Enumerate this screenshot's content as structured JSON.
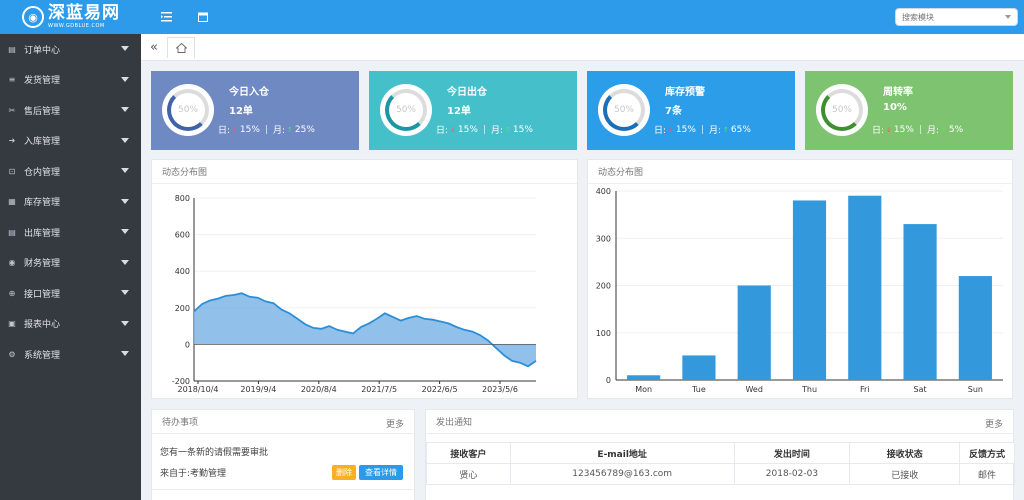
{
  "header": {
    "logo_title": "深蓝易网",
    "logo_sub": "WWW.GDBLUE.COM",
    "search_placeholder": "搜索模块"
  },
  "sidebar": {
    "items": [
      {
        "label": "订单中心",
        "icon": "order-icon"
      },
      {
        "label": "发货管理",
        "icon": "shipping-icon"
      },
      {
        "label": "售后管理",
        "icon": "aftersale-icon"
      },
      {
        "label": "入库管理",
        "icon": "inbound-icon"
      },
      {
        "label": "仓内管理",
        "icon": "warehouse-icon"
      },
      {
        "label": "库存管理",
        "icon": "inventory-icon"
      },
      {
        "label": "出库管理",
        "icon": "outbound-icon"
      },
      {
        "label": "财务管理",
        "icon": "finance-icon"
      },
      {
        "label": "接口管理",
        "icon": "api-icon"
      },
      {
        "label": "报表中心",
        "icon": "report-icon"
      },
      {
        "label": "系统管理",
        "icon": "gear-icon"
      }
    ]
  },
  "cards": [
    {
      "title": "今日入仓",
      "value": "12单",
      "ring": "50%",
      "day_label": "日:",
      "day": "15%",
      "month_label": "月:",
      "month": "25%",
      "color": "#6f89c3",
      "ring_color": "#3e63a8"
    },
    {
      "title": "今日出仓",
      "value": "12单",
      "ring": "50%",
      "day_label": "日:",
      "day": "15%",
      "month_label": "月:",
      "month": "15%",
      "color": "#45bfc9",
      "ring_color": "#1a97a3"
    },
    {
      "title": "库存预警",
      "value": "7条",
      "ring": "50%",
      "day_label": "日:",
      "day": "15%",
      "month_label": "月:",
      "month": "65%",
      "color": "#2c9de9",
      "ring_color": "#1b6fb8"
    },
    {
      "title": "周转率",
      "value": "10%",
      "ring": "50%",
      "day_label": "日:",
      "day": "15%",
      "month_label": "月:",
      "month": "5%",
      "color": "#7ec36f",
      "ring_color": "#3e8f2f"
    }
  ],
  "charts": {
    "left_title": "动态分布图",
    "right_title": "动态分布图"
  },
  "chart_data": [
    {
      "type": "area",
      "title": "动态分布图",
      "x_ticks": [
        "2018/10/4",
        "2019/9/4",
        "2020/8/4",
        "2021/7/5",
        "2022/6/5",
        "2023/5/6"
      ],
      "y_ticks": [
        800,
        600,
        400,
        200,
        0,
        -200
      ],
      "ylim": [
        -200,
        800
      ],
      "series": [
        {
          "values": [
            180,
            220,
            240,
            250,
            265,
            270,
            280,
            260,
            255,
            235,
            225,
            190,
            170,
            140,
            110,
            90,
            85,
            100,
            80,
            70,
            60,
            95,
            115,
            140,
            170,
            150,
            130,
            145,
            155,
            140,
            135,
            125,
            115,
            95,
            80,
            70,
            50,
            20,
            -20,
            -60,
            -90,
            -100,
            -120,
            -90
          ]
        }
      ],
      "color": "#2b8fd8"
    },
    {
      "type": "bar",
      "title": "动态分布图",
      "categories": [
        "Mon",
        "Tue",
        "Wed",
        "Thu",
        "Fri",
        "Sat",
        "Sun"
      ],
      "values": [
        10,
        52,
        200,
        380,
        390,
        330,
        220
      ],
      "y_ticks": [
        400,
        300,
        200,
        100,
        0
      ],
      "ylim": [
        0,
        400
      ],
      "color": "#3398dc"
    }
  ],
  "todo": {
    "title": "待办事项",
    "more": "更多",
    "line1": "您有一条新的请假需要审批",
    "line2": "来自于:考勤管理",
    "delete_btn": "删除",
    "view_btn": "查看详情"
  },
  "notice": {
    "title": "发出通知",
    "more": "更多",
    "columns": [
      "接收客户",
      "E-mail地址",
      "发出时间",
      "接收状态",
      "反馈方式"
    ],
    "rows": [
      [
        "贤心",
        "123456789@163.com",
        "2018-02-03",
        "已接收",
        "邮件"
      ]
    ]
  }
}
